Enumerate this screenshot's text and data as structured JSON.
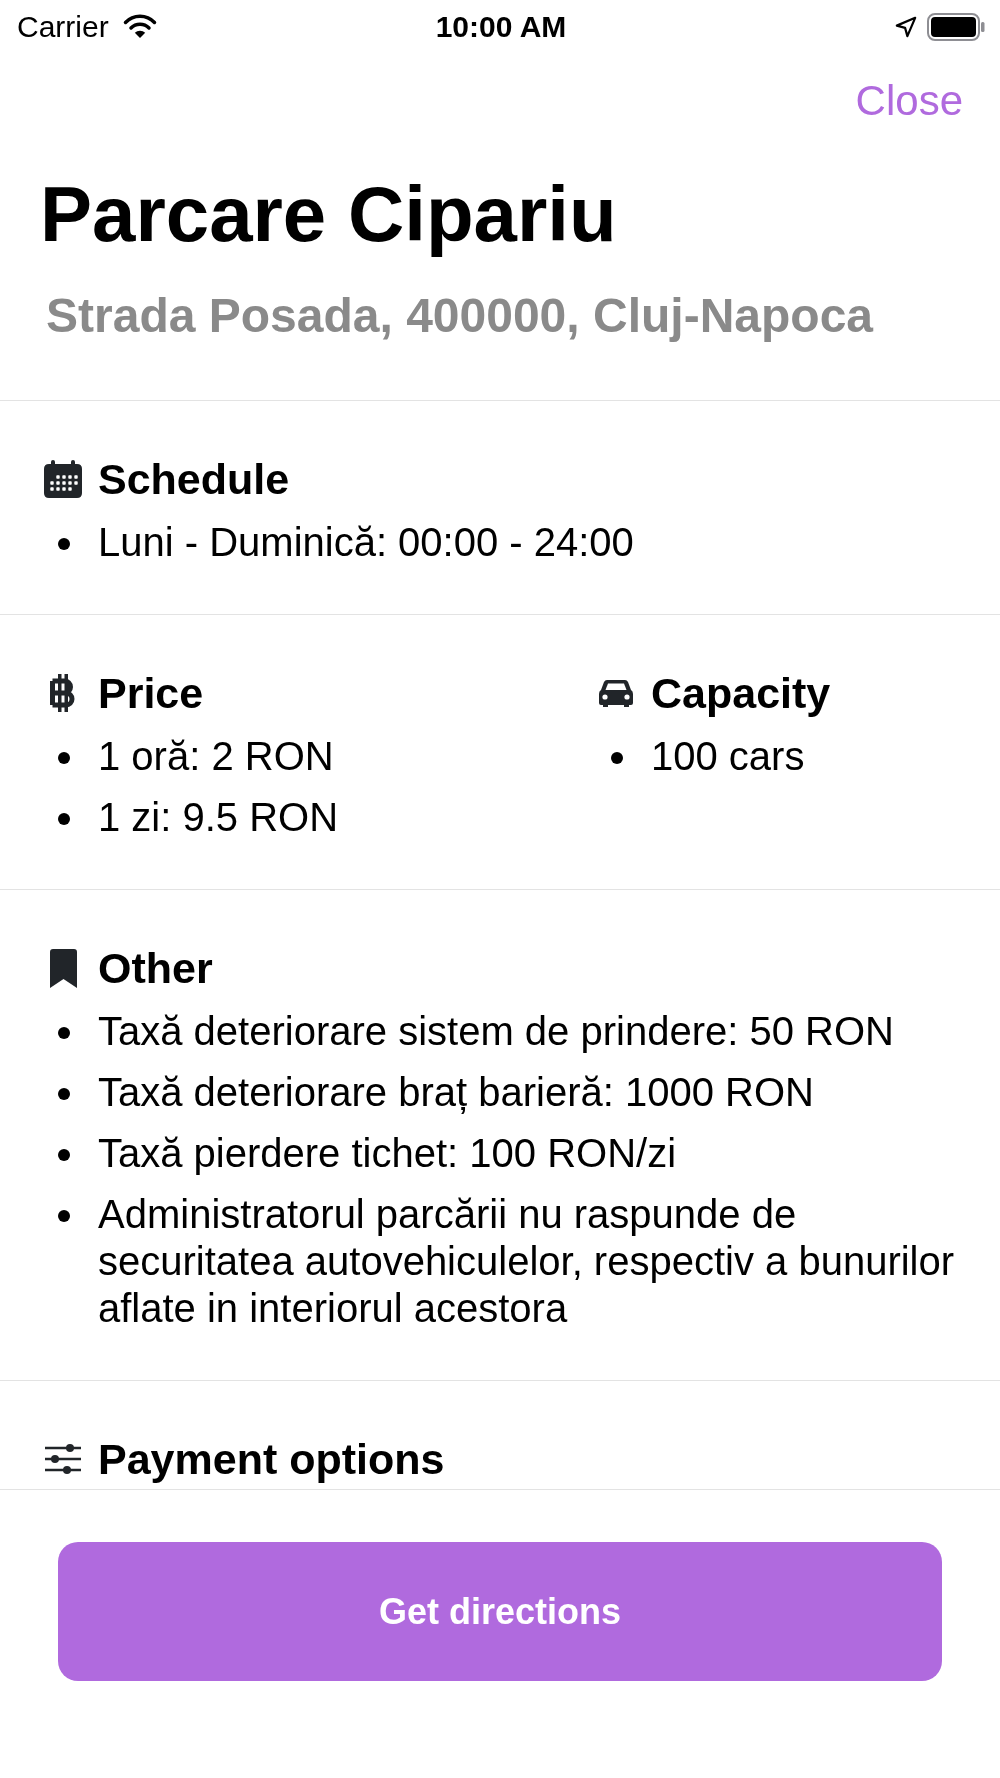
{
  "status_bar": {
    "carrier": "Carrier",
    "time": "10:00 AM"
  },
  "header": {
    "close_button": "Close",
    "title": "Parcare Cipariu",
    "address": "Strada Posada, 400000, Cluj-Napoca"
  },
  "sections": [
    {
      "groups": [
        {
          "heading": "Schedule",
          "items": [
            "Luni - Duminică: 00:00 - 24:00"
          ]
        }
      ]
    },
    {
      "groups": [
        {
          "heading": "Price",
          "items": [
            "1 oră: 2 RON",
            "1 zi: 9.5 RON"
          ]
        },
        {
          "heading": "Capacity",
          "items": [
            "100 cars"
          ]
        }
      ]
    },
    {
      "groups": [
        {
          "heading": "Other",
          "items": [
            "Taxă deteriorare sistem de prindere: 50 RON",
            "Taxă deteriorare braț barieră: 1000 RON",
            "Taxă pierdere tichet: 100 RON/zi",
            "Administratorul parcării nu raspunde de securitatea autovehiculelor, respectiv a bunurilor aflate in interiorul acestora"
          ]
        }
      ]
    },
    {
      "groups": [
        {
          "heading": "Payment options"
        }
      ]
    }
  ],
  "button": "Get directions"
}
